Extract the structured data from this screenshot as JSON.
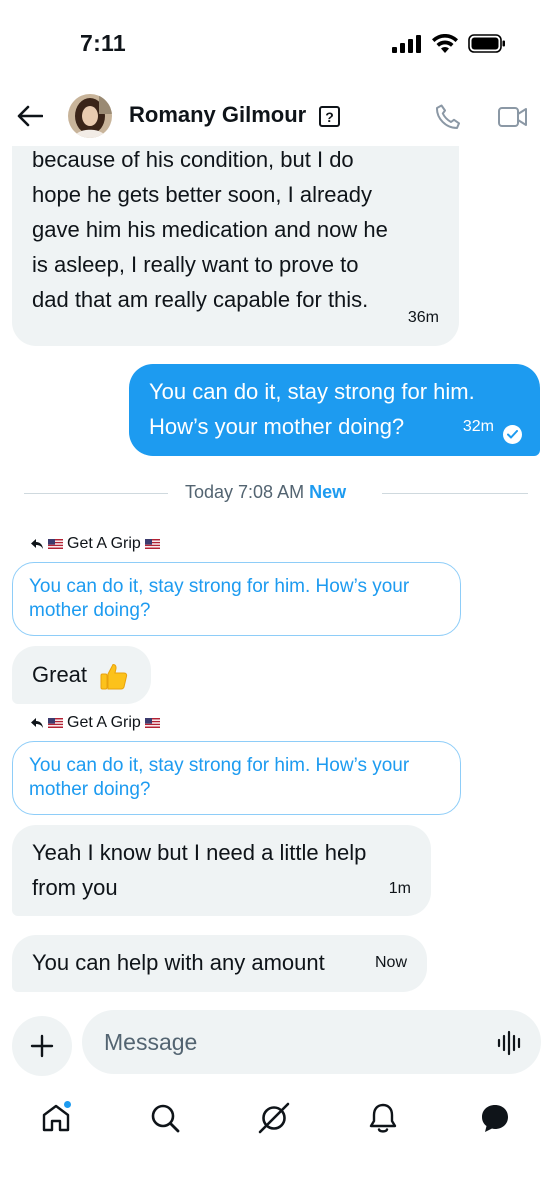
{
  "status_bar": {
    "time": "7:11"
  },
  "header": {
    "contact_name": "Romany Gilmour",
    "unknown_badge": "?"
  },
  "messages": [
    {
      "direction": "incoming",
      "lines": [
        "because of his condition, but I do",
        "hope he gets better soon, I already",
        "gave him his medication and now he",
        "is asleep, I really want to prove to",
        "dad that am really capable for this."
      ],
      "time": "36m"
    },
    {
      "direction": "outgoing",
      "lines": [
        "You can do it, stay strong for him.",
        "How’s your mother doing?"
      ],
      "time": "32m",
      "status": "read"
    }
  ],
  "divider": {
    "label": "Today 7:08 AM",
    "new_label": "New"
  },
  "replies": [
    {
      "reply_to_name": "Get A Grip",
      "quote_lines": [
        "You can do it, stay strong for him. How’s your",
        "mother doing?"
      ],
      "text": "Great"
    },
    {
      "reply_to_name": "Get A Grip",
      "quote_lines": [
        "You can do it, stay strong for him. How’s your",
        "mother doing?"
      ],
      "lines": [
        "Yeah I know but I need a little help",
        "from you"
      ],
      "time": "1m"
    }
  ],
  "last_message": {
    "text": "You can help with any amount",
    "time": "Now"
  },
  "composer": {
    "placeholder": "Message"
  },
  "bottom_nav": {
    "items": [
      "home-icon",
      "search-icon",
      "grok-icon",
      "notifications-icon",
      "messages-icon"
    ],
    "home_has_dot": true
  },
  "colors": {
    "accent": "#1d9bf0",
    "bubble_incoming": "#eff3f4",
    "text_primary": "#0f1419",
    "text_secondary": "#536471"
  }
}
